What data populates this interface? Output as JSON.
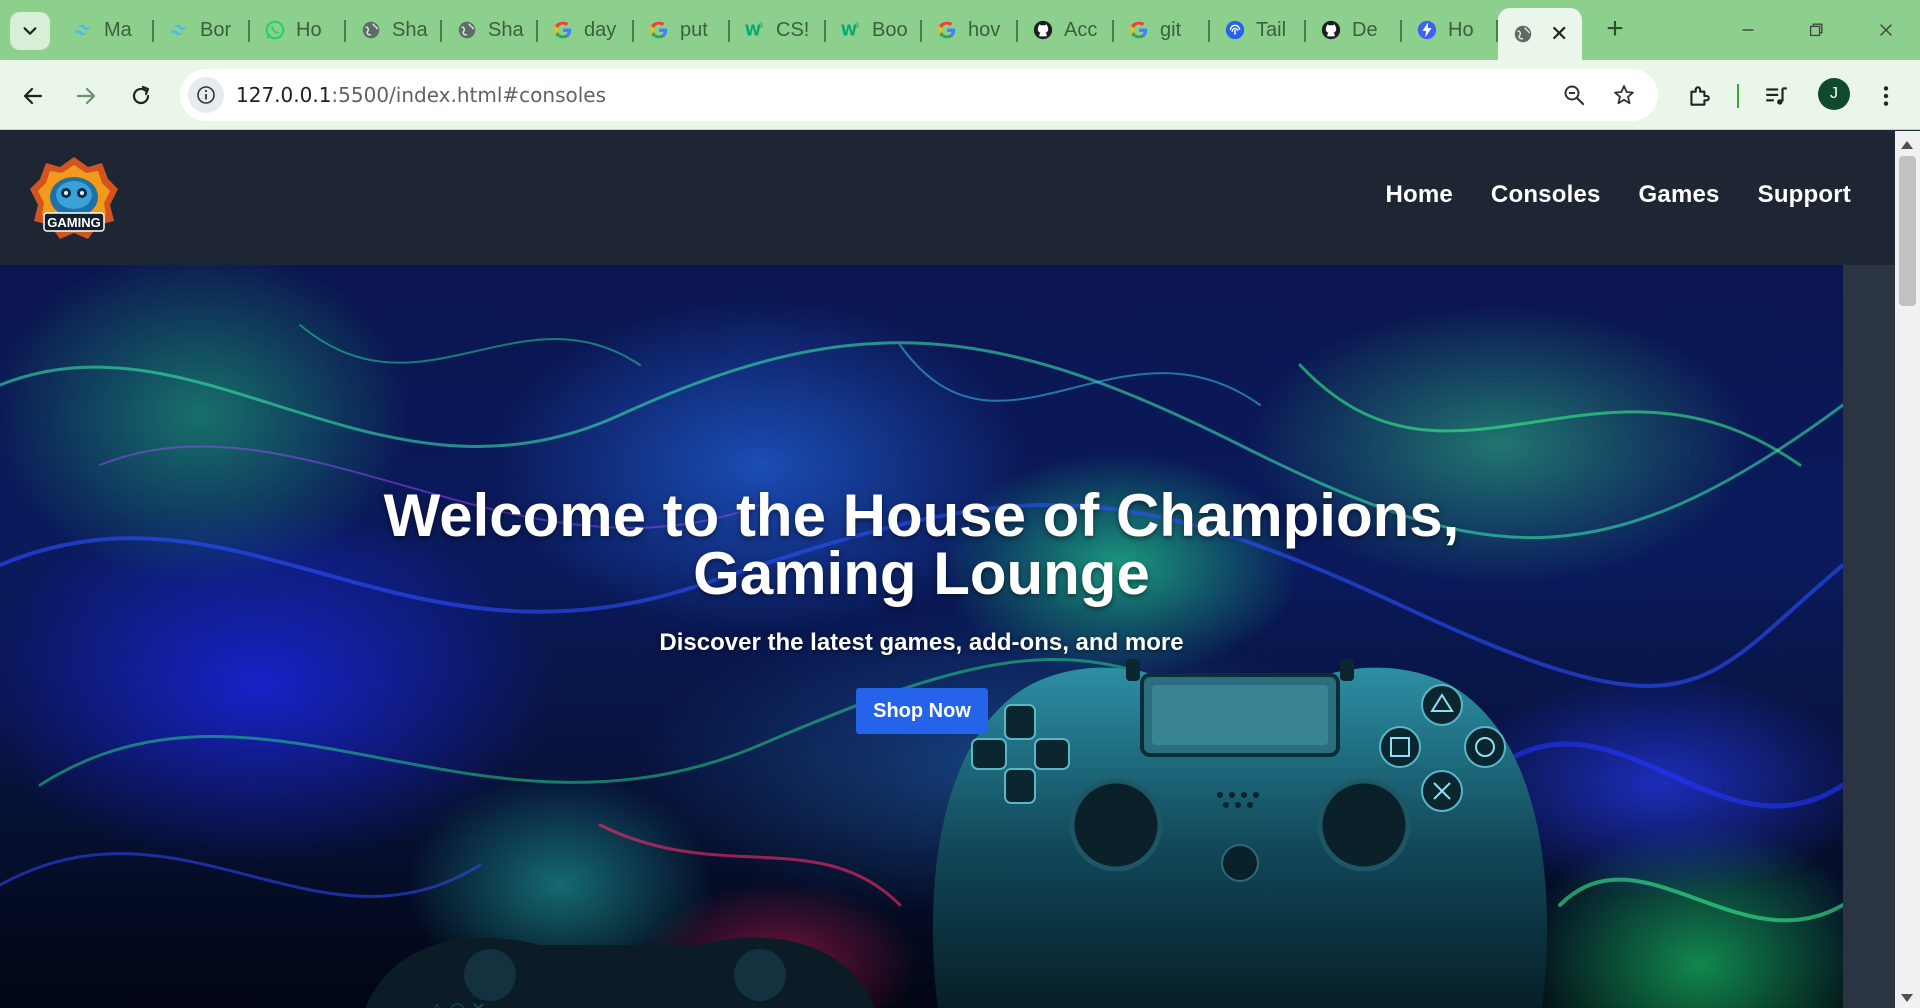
{
  "browser": {
    "tabs": [
      {
        "title": "Ma",
        "icon": "tailwind-icon"
      },
      {
        "title": "Bor",
        "icon": "tailwind-icon"
      },
      {
        "title": "Ho",
        "icon": "whatsapp-icon"
      },
      {
        "title": "Sha",
        "icon": "globe-icon"
      },
      {
        "title": "Sha",
        "icon": "globe-icon"
      },
      {
        "title": "day",
        "icon": "google-icon"
      },
      {
        "title": "put",
        "icon": "google-icon"
      },
      {
        "title": "CS!",
        "icon": "w3schools-icon"
      },
      {
        "title": "Boo",
        "icon": "w3schools-icon"
      },
      {
        "title": "hov",
        "icon": "google-icon"
      },
      {
        "title": "Acc",
        "icon": "github-icon"
      },
      {
        "title": "git",
        "icon": "google-icon"
      },
      {
        "title": "Tail",
        "icon": "fingerprint-icon"
      },
      {
        "title": "De",
        "icon": "github-icon"
      },
      {
        "title": "Ho",
        "icon": "bolt-icon"
      }
    ],
    "active_tab": {
      "title": "",
      "icon": "globe-icon"
    },
    "url_host": "127.0.0.1",
    "url_rest": ":5500/index.html#consoles",
    "profile_initial": "J",
    "accent": "#8dcf8d"
  },
  "site": {
    "logo_text": "GAMING",
    "nav": [
      "Home",
      "Consoles",
      "Games",
      "Support"
    ],
    "hero": {
      "title_line1": "Welcome to the House of Champions,",
      "title_line2": "Gaming Lounge",
      "subtitle": "Discover the latest games, add-ons, and more",
      "cta": "Shop Now"
    },
    "colors": {
      "header": "#1e2633",
      "cta": "#2563eb"
    }
  }
}
